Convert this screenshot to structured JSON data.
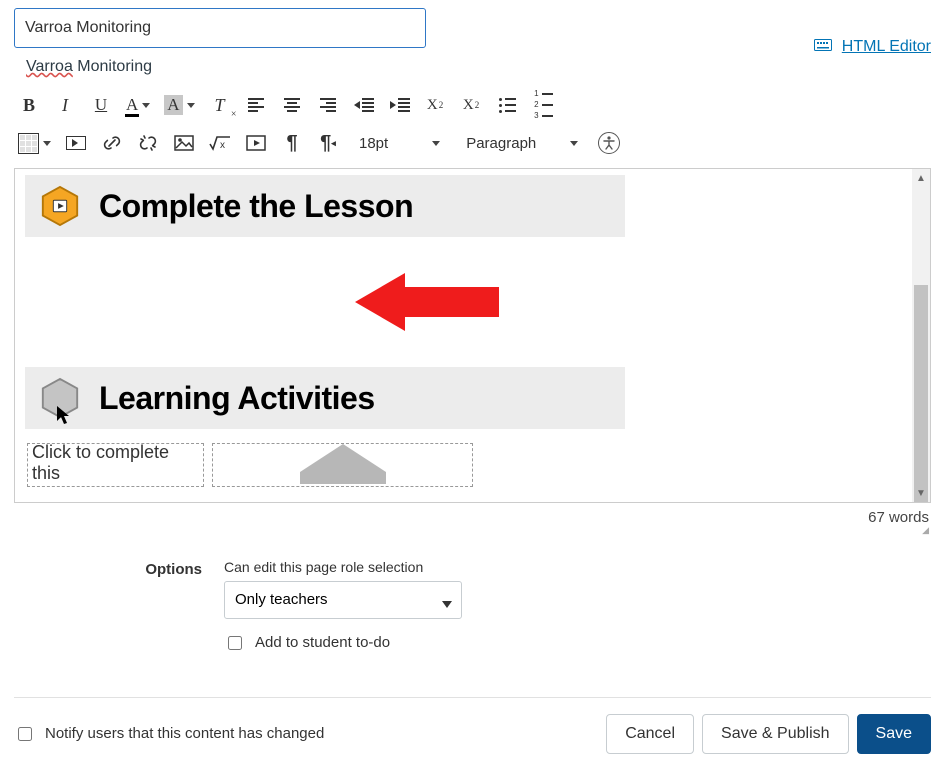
{
  "title": {
    "value": "Varroa Monitoring",
    "misspelled_word": "Varroa"
  },
  "html_editor_link": "HTML Editor",
  "toolbar": {
    "font_size": "18pt",
    "block_format": "Paragraph"
  },
  "content": {
    "banner1": "Complete the Lesson",
    "banner2": "Learning Activities",
    "placeholder_text": "Click to complete this"
  },
  "word_count": "67 words",
  "options": {
    "section_label": "Options",
    "role_label": "Can edit this page role selection",
    "role_value": "Only teachers",
    "todo_label": "Add to student to-do"
  },
  "footer": {
    "notify_label": "Notify users that this content has changed",
    "cancel": "Cancel",
    "save_publish": "Save & Publish",
    "save": "Save"
  }
}
